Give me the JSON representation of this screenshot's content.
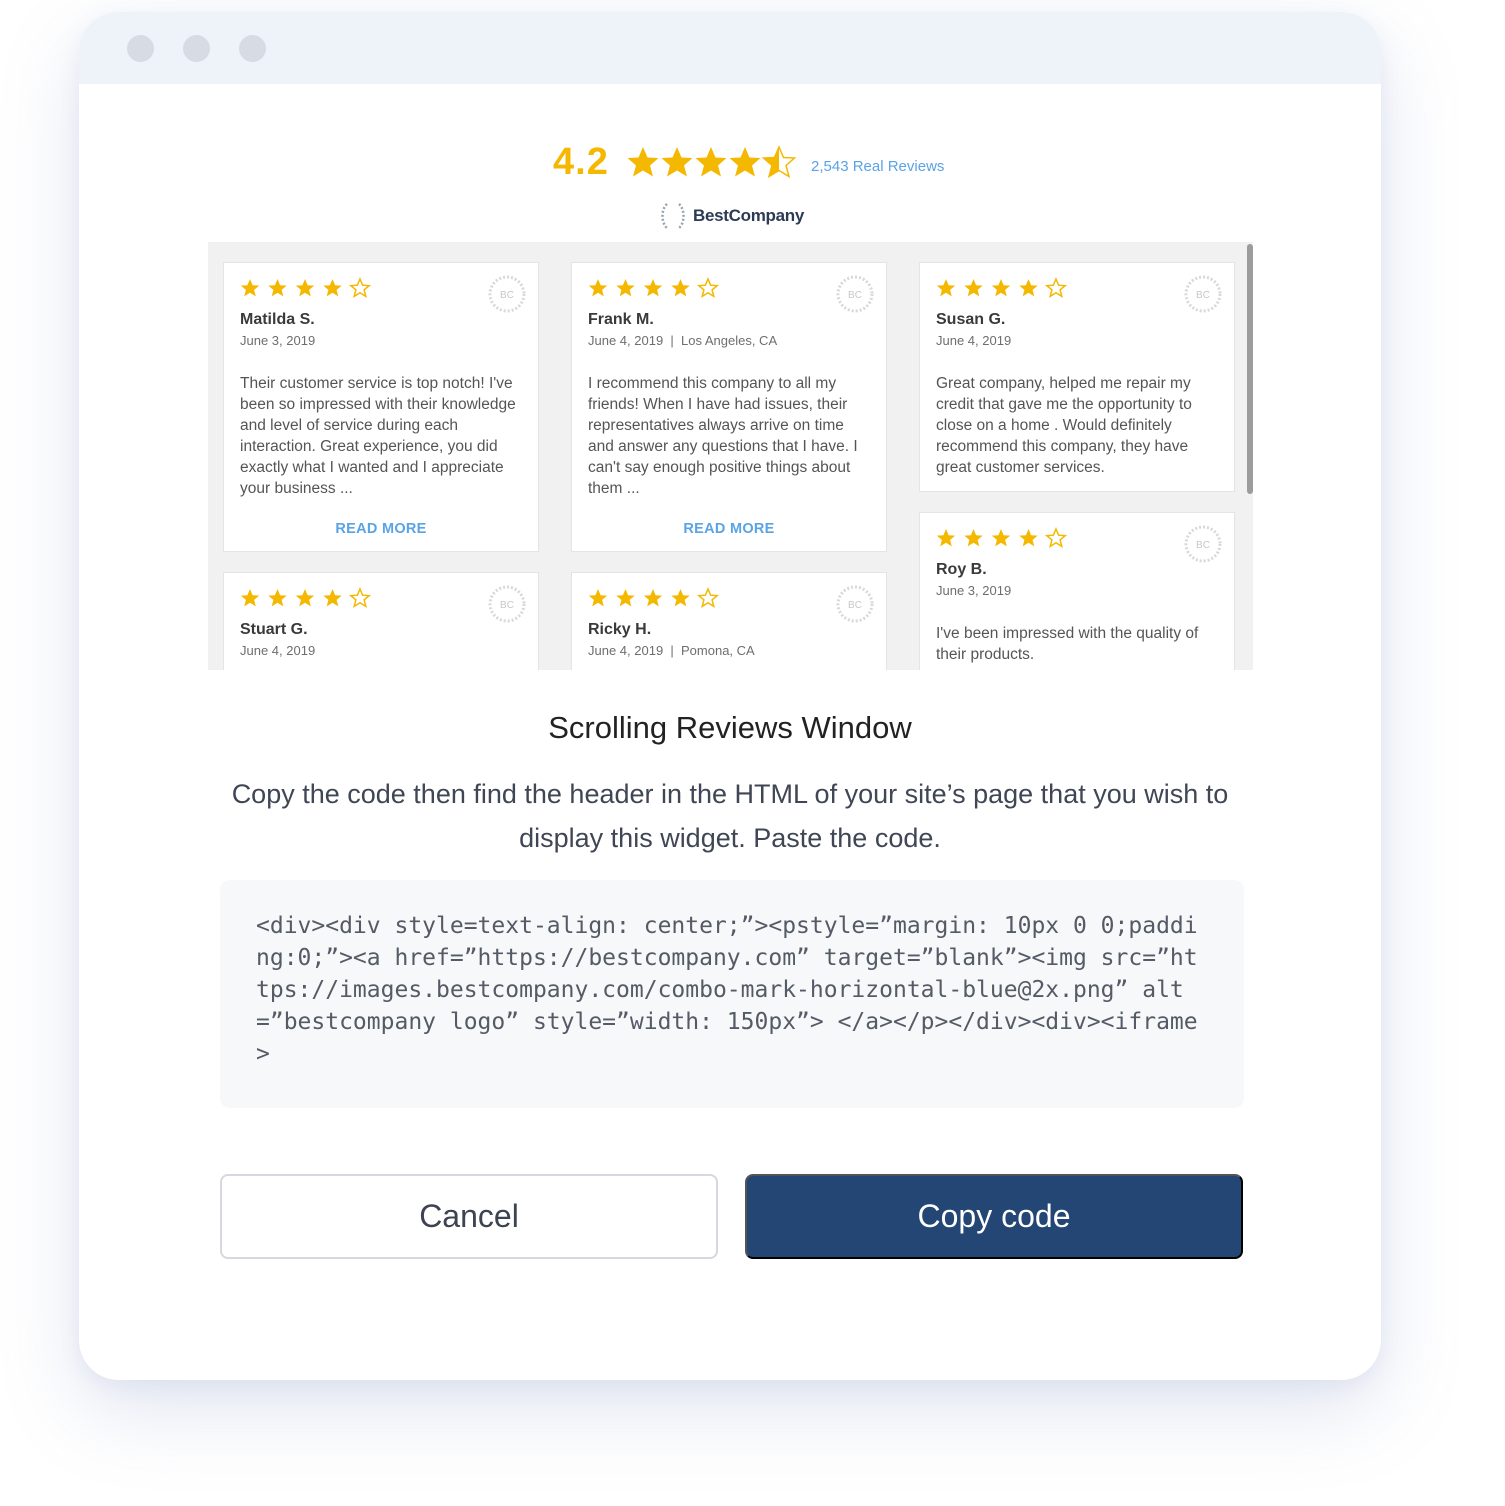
{
  "colors": {
    "star": "#f5b800",
    "link": "#5aa3e6",
    "primary_button": "#244675",
    "titlebar": "#eef2f9"
  },
  "widget": {
    "score": "4.2",
    "review_count": "2,543 Real Reviews",
    "brand_name": "BestCompany",
    "read_more_label": "READ MORE",
    "badge_label": "BC",
    "reviews": [
      {
        "stars": 4,
        "name": "Matilda S.",
        "meta": "June 3, 2019",
        "text": "Their customer service is top notch! I've been so impressed with their knowledge and level of service during each interaction. Great experience, you did exactly what I wanted and I appreciate your business ...",
        "read_more": true
      },
      {
        "stars": 4,
        "name": "Frank M.",
        "meta": "June 4, 2019  |  Los Angeles, CA",
        "text": "I recommend this company to all my friends! When I have had issues, their representatives always arrive on time and answer any questions that I have. I can't say enough positive things about them ...",
        "read_more": true
      },
      {
        "stars": 4,
        "name": "Susan G.",
        "meta": "June 4, 2019",
        "text": "Great company, helped me repair my credit that gave me the opportunity to close on a home . Would definitely recommend this company, they have great customer services.",
        "read_more": false
      },
      {
        "stars": 4,
        "name": "Stuart G.",
        "meta": "June 4, 2019",
        "text": "",
        "read_more": false
      },
      {
        "stars": 4,
        "name": "Ricky H.",
        "meta": "June 4, 2019  |  Pomona, CA",
        "text": "",
        "read_more": false
      },
      {
        "stars": 4,
        "name": "Roy B.",
        "meta": "June 3, 2019",
        "text": "I've been impressed with the quality of their products.",
        "read_more": false
      }
    ]
  },
  "dialog": {
    "title": "Scrolling Reviews Window",
    "description": "Copy the code then find the header in the HTML of your site’s page that you wish to display this widget. Paste the code.",
    "code": "<div><div style=text-align: center;”><pstyle=”margin: 10px 0 0;padding:0;”><a href=”https://bestcompany.com” target=”blank”><img src=”https://images.bestcompany.com/combo-mark-horizontal-blue@2x.png” alt=”bestcompany logo” style=”width: 150px”> </a></p></div><div><iframe>",
    "cancel_label": "Cancel",
    "copy_label": "Copy code"
  }
}
